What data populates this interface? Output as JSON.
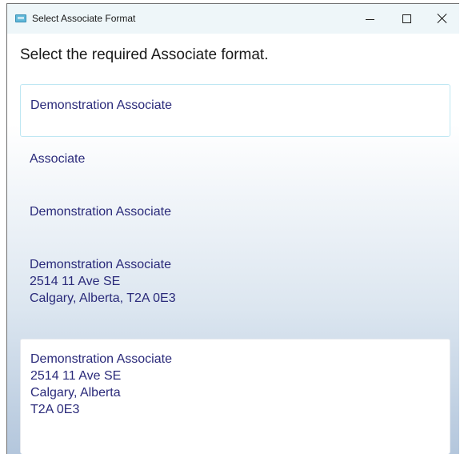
{
  "window": {
    "title": "Select Associate Format",
    "app_icon": "keyboard-icon",
    "controls": {
      "minimize": "minimize-icon",
      "maximize": "maximize-icon",
      "close": "close-icon"
    }
  },
  "prompt": "Select the required Associate format.",
  "options": [
    {
      "lines": [
        "Demonstration Associate"
      ]
    },
    {
      "lines": [
        "Associate"
      ]
    },
    {
      "lines": [
        "Demonstration Associate"
      ]
    },
    {
      "lines": [
        "Demonstration Associate",
        "2514 11 Ave SE",
        "Calgary, Alberta, T2A 0E3"
      ]
    },
    {
      "lines": [
        "Demonstration Associate",
        "2514 11 Ave SE",
        "Calgary, Alberta",
        "T2A 0E3"
      ]
    }
  ],
  "colors": {
    "title_bar": "#eef6f9",
    "option_text": "#2a2a7a",
    "focus_border": "#bfe7f3",
    "gradient_bottom": "#b3c6dc"
  }
}
